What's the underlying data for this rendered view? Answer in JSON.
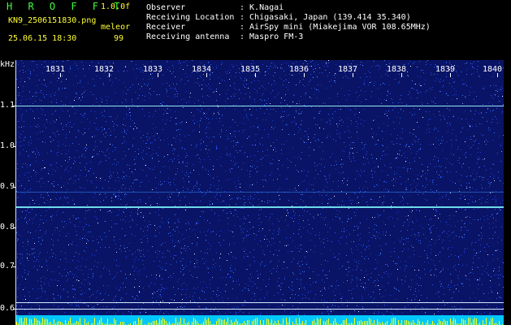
{
  "header": {
    "brand": "H R O F F T",
    "version": "1.0.0f",
    "filename": "KN9_2506151830.png",
    "mode": "meleor",
    "datetime": "25.06.15 18:30",
    "count": "99",
    "fields": [
      {
        "label": "Observer",
        "value": ": K.Nagai"
      },
      {
        "label": "Receiving Location",
        "value": ": Chigasaki, Japan (139.414 35.340)"
      },
      {
        "label": "Receiver",
        "value": ": AirSpy mini (Miakejima VOR 108.65MHz)"
      },
      {
        "label": "Receiving antenna",
        "value": ": Maspro FM-3"
      }
    ]
  },
  "axis": {
    "unit": "kHz",
    "y_ticks": [
      "1.1",
      "1.0",
      "0.9",
      "0.8",
      "0.7",
      "0.6"
    ],
    "x_ticks": [
      "1831",
      "1832",
      "1833",
      "1834",
      "1835",
      "1836",
      "1837",
      "1838",
      "1839",
      "1840"
    ]
  },
  "colors": {
    "background": "#0a1466",
    "signal": "#7fffff",
    "header_text": "#ffffff",
    "brand": "#3cff3c",
    "info": "#ffff33"
  }
}
